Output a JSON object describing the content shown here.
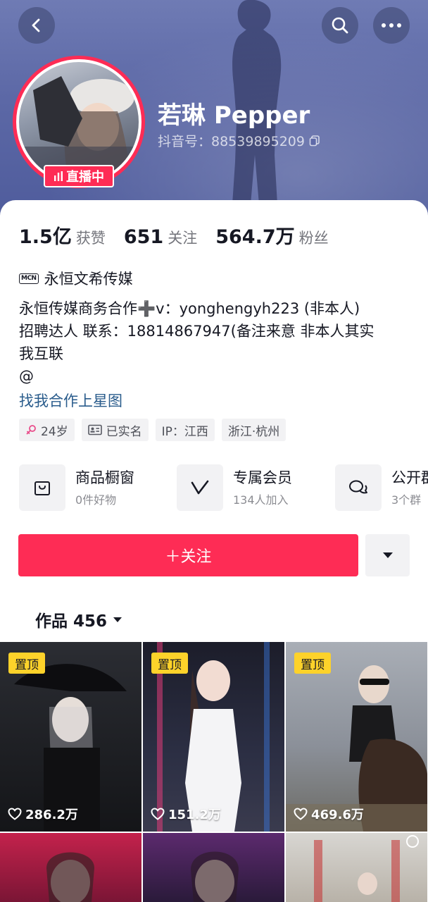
{
  "header": {
    "nickname": "若琳 Pepper",
    "douyin_id": "抖音号：88539895209",
    "live_badge": "直播中",
    "icons": {
      "back": "chevron-left-icon",
      "search": "search-icon",
      "more": "more-dots-icon",
      "copy": "copy-icon"
    }
  },
  "stats": [
    {
      "value": "1.5亿",
      "label": "获赞"
    },
    {
      "value": "651",
      "label": "关注"
    },
    {
      "value": "564.7万",
      "label": "粉丝"
    }
  ],
  "mcn": {
    "tag": "MCN",
    "name": "永恒文希传媒"
  },
  "bio": {
    "line1": "永恒传媒商务合作➕v：yonghengyh223 (非本人)",
    "line2": "招聘达人  联系：18814867947(备注来意 非本人其实",
    "line3": "我互联",
    "line4": "@"
  },
  "star_link": "找我合作上星图",
  "tags": [
    {
      "icon": "female-icon",
      "text": "24岁"
    },
    {
      "icon": "id-card-icon",
      "text": "已实名"
    },
    {
      "icon": "",
      "text": "IP：江西"
    },
    {
      "icon": "",
      "text": "浙江·杭州"
    }
  ],
  "services": [
    {
      "icon": "shopping-bag-icon",
      "title": "商品橱窗",
      "subtitle": "0件好物"
    },
    {
      "icon": "vip-v-icon",
      "title": "专属会员",
      "subtitle": "134人加入"
    },
    {
      "icon": "group-chat-icon",
      "title": "公开群",
      "subtitle": "3个群"
    }
  ],
  "actions": {
    "follow_label": "＋关注",
    "dropdown_icon": "caret-down-icon"
  },
  "works_tab": {
    "label": "作品 456"
  },
  "videos": [
    {
      "pinned": "置顶",
      "likes": "286.2万"
    },
    {
      "pinned": "置顶",
      "likes": "151.2万"
    },
    {
      "pinned": "置顶",
      "likes": "469.6万"
    },
    {
      "pinned": "",
      "likes": ""
    },
    {
      "pinned": "",
      "likes": ""
    },
    {
      "pinned": "",
      "likes": ""
    }
  ],
  "colors": {
    "accent": "#fe2c55",
    "link": "#2a5c8c",
    "pin_badge": "#fdd22a",
    "header_bg": "#5c68a6"
  }
}
